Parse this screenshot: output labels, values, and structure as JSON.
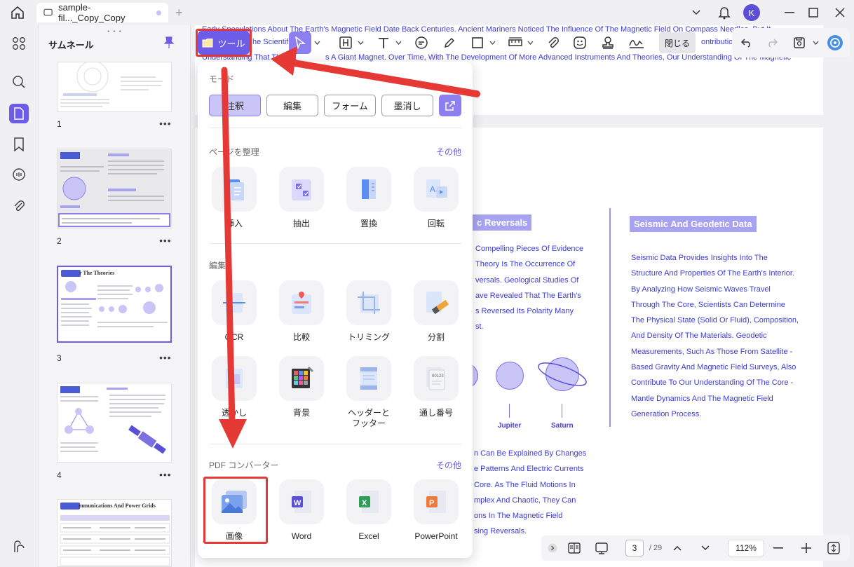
{
  "tab": {
    "title": "sample-fil..._Copy_Copy"
  },
  "thumbnails": {
    "title": "サムネール",
    "pages": [
      "1",
      "2",
      "3",
      "4"
    ],
    "page3_heading": "r The Theories",
    "page5_heading": "mmunications And Power Grids"
  },
  "toolbar": {
    "tool_label": "ツール",
    "close_label": "閉じる"
  },
  "popup": {
    "mode_title": "モード",
    "modes": [
      "注釈",
      "編集",
      "フォーム",
      "墨消し"
    ],
    "organize_title": "ページを整理",
    "more": "その他",
    "organize": [
      "挿入",
      "抽出",
      "置換",
      "回転"
    ],
    "edit_title": "編集",
    "edit_row1": [
      "OCR",
      "比較",
      "トリミング",
      "分割"
    ],
    "edit_row2": [
      "透かし",
      "背景",
      "ヘッダーと\nフッター",
      "通し番号"
    ],
    "converter_title": "PDF コンバーター",
    "converter": [
      "画像",
      "Word",
      "Excel",
      "PowerPoint"
    ]
  },
  "document": {
    "top_lines": [
      "Early Speculations About The Earth's Magnetic Field Date Back Centuries. Ancient Mariners Noticed The Influence Of The Magnetic Field On Compass Needles, But It",
      "he Scientif",
      "ontributions",
      "Understanding That The Ea",
      "s A Giant Magnet. Over Time, With The Development Of More Advanced Instruments And Theories, Our Understanding Of The Magnetic"
    ],
    "badge_reversals": "c Reversals",
    "badge_seismic": "Seismic And Geodetic Data",
    "middle_lines": [
      "Compelling Pieces Of Evidence",
      "Theory Is The Occurrence Of",
      "versals. Geological Studies Of",
      "ave Revealed That The Earth's",
      "s Reversed Its Polarity Many",
      "st."
    ],
    "right_lines": [
      "Seismic Data Provides Insights Into The",
      "Structure And Properties Of The Earth's Interior.",
      "By Analyzing How Seismic Waves Travel",
      "Through The Core, Scientists Can Determine",
      "The Physical State (Solid Or Fluid), Composition,",
      "And Density Of The Materials. Geodetic",
      "Measurements, Such As Those From Satellite -",
      "Based Gravity And Magnetic Field Surveys, Also",
      "Contribute To Our Understanding Of The Core -",
      "Mantle Dynamics And The Magnetic Field",
      "Generation Process."
    ],
    "planets": [
      "Jupiter",
      "Saturn"
    ],
    "lower_lines": [
      "n Can Be Explained By Changes",
      "e Patterns And Electric Currents",
      "Core. As The Fluid Motions In",
      "mplex And Chaotic, They Can",
      "ons In The Magnetic Field",
      "sing Reversals."
    ]
  },
  "bottom": {
    "page": "3",
    "total": "/ 29",
    "zoom": "112%"
  },
  "colors": {
    "accent": "#6c5ce7",
    "highlight": "#e53935",
    "text_blue": "#3b3bd8"
  }
}
